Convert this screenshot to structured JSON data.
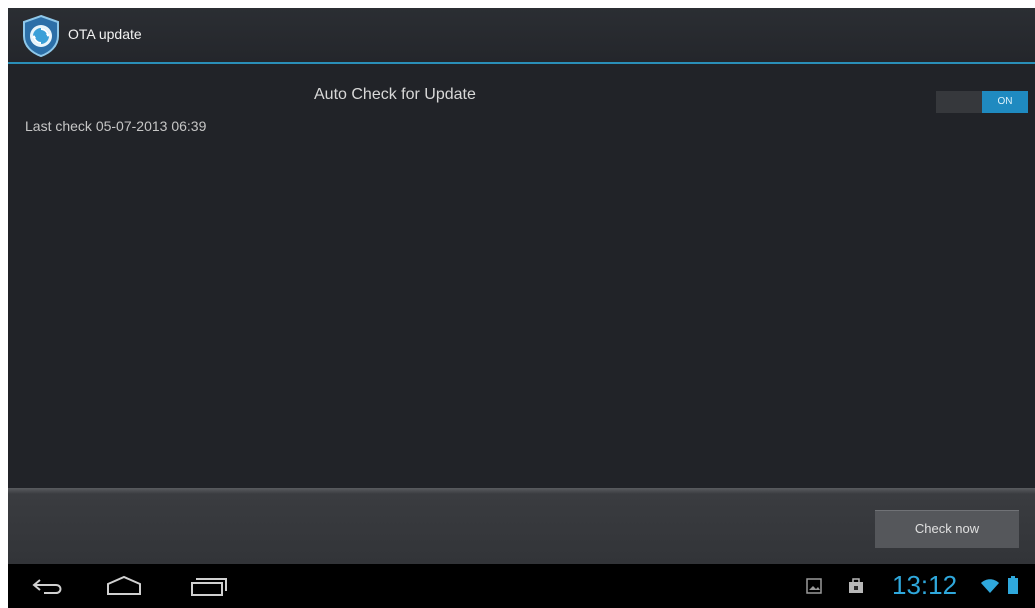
{
  "action_bar": {
    "title": "OTA update",
    "icon": "ota-shield-icon"
  },
  "preference": {
    "title": "Auto Check for Update",
    "summary": "Last check 05-07-2013 06:39",
    "toggle_state": "ON"
  },
  "button_bar": {
    "check_label": "Check now"
  },
  "nav_bar": {
    "icons": [
      "back-icon",
      "home-icon",
      "recent-apps-icon"
    ]
  },
  "status_bar": {
    "time": "13:12",
    "icons": [
      "gallery-notification-icon",
      "briefcase-notification-icon",
      "wifi-icon",
      "battery-icon"
    ]
  },
  "colors": {
    "accent": "#2a8fb8",
    "background": "#212328",
    "toggle_on": "#1f8ac0",
    "clock": "#2fa8dc"
  }
}
